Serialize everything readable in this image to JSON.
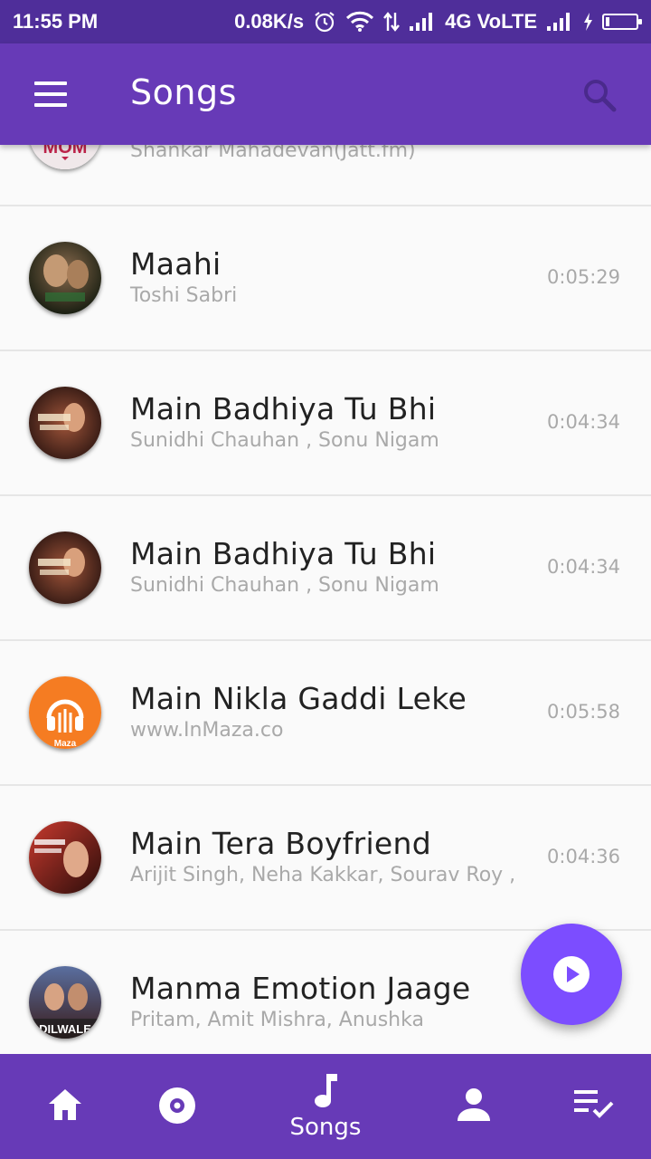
{
  "status_bar": {
    "time": "11:55 PM",
    "net_speed": "0.08K/s",
    "network": "4G VoLTE",
    "icons": [
      "alarm-icon",
      "wifi-icon",
      "data-arrows-icon",
      "signal-icon",
      "signal-icon-2",
      "charging-icon",
      "battery-icon"
    ]
  },
  "toolbar": {
    "title": "Songs",
    "menu_icon": "menu-icon",
    "search_icon": "search-icon"
  },
  "songs": [
    {
      "title": "",
      "artist": "Shankar Mahadevan(Jatt.fm)",
      "duration": "",
      "art_label": "MOM"
    },
    {
      "title": "Maahi",
      "artist": "Toshi Sabri",
      "duration": "0:05:29",
      "art_label": ""
    },
    {
      "title": "Main Badhiya Tu Bhi",
      "artist": "Sunidhi Chauhan , Sonu Nigam",
      "duration": "0:04:34",
      "art_label": ""
    },
    {
      "title": "Main Badhiya Tu Bhi",
      "artist": "Sunidhi Chauhan , Sonu Nigam",
      "duration": "0:04:34",
      "art_label": ""
    },
    {
      "title": "Main Nikla Gaddi Leke",
      "artist": "www.InMaza.co",
      "duration": "0:05:58",
      "art_label": "Maza"
    },
    {
      "title": "Main Tera Boyfriend",
      "artist": "Arijit Singh, Neha Kakkar, Sourav Roy ,",
      "duration": "0:04:36",
      "art_label": ""
    },
    {
      "title": "Manma Emotion Jaage",
      "artist": "Pritam, Amit Mishra, Anushka",
      "duration": "",
      "art_label": "DILWALE"
    }
  ],
  "fab": {
    "icon": "play-icon"
  },
  "bottom_nav": [
    {
      "icon": "home-icon",
      "label": ""
    },
    {
      "icon": "album-icon",
      "label": ""
    },
    {
      "icon": "music-note-icon",
      "label": "Songs"
    },
    {
      "icon": "artist-icon",
      "label": ""
    },
    {
      "icon": "playlist-icon",
      "label": ""
    }
  ],
  "colors": {
    "primary": "#673ab7",
    "status_bar": "#4f2e9a",
    "accent": "#7c4dff"
  }
}
